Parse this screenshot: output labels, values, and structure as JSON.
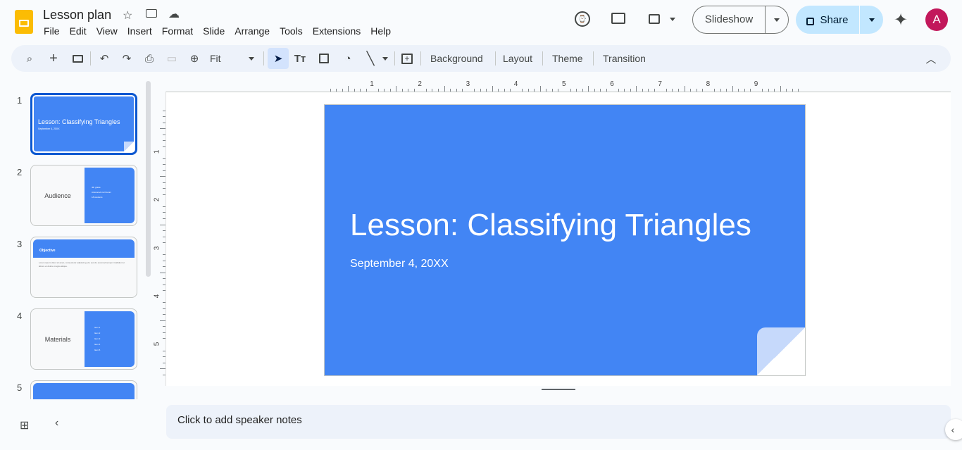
{
  "app": {
    "title": "Lesson plan",
    "menu": [
      "File",
      "Edit",
      "View",
      "Insert",
      "Format",
      "Slide",
      "Arrange",
      "Tools",
      "Extensions",
      "Help"
    ]
  },
  "header": {
    "slideshow": "Slideshow",
    "share": "Share",
    "avatar": "A"
  },
  "toolbar": {
    "zoom": "Fit",
    "background": "Background",
    "layout": "Layout",
    "theme": "Theme",
    "transition": "Transition"
  },
  "slides": [
    {
      "num": "1",
      "title": "Lesson: Classifying Triangles",
      "subtitle": "September 4, 20XX"
    },
    {
      "num": "2",
      "title": "Audience",
      "bullets": [
        "4th grade",
        "Advanced curriculum",
        "18 students"
      ]
    },
    {
      "num": "3",
      "title": "Objective",
      "body": "Lorem ipsum dolor sit amet, consectetur adipiscing elit, sed do eiusmod tempor incididunt ut labore et dolore magna aliqua."
    },
    {
      "num": "4",
      "title": "Materials",
      "bullets": [
        "Item 1",
        "Item 2",
        "Item 3",
        "Item 4",
        "Item 5"
      ]
    },
    {
      "num": "5"
    }
  ],
  "ruler": {
    "h": [
      "1",
      "2",
      "3",
      "4",
      "5",
      "6",
      "7",
      "8",
      "9"
    ],
    "v": [
      "1",
      "2",
      "3",
      "4",
      "5"
    ]
  },
  "main": {
    "title": "Lesson: Classifying Triangles",
    "subtitle": "September 4, 20XX"
  },
  "notes": {
    "placeholder": "Click to add speaker notes"
  },
  "colors": {
    "accent": "#4285f4",
    "share_bg": "#c2e7ff",
    "avatar": "#c2185b"
  }
}
